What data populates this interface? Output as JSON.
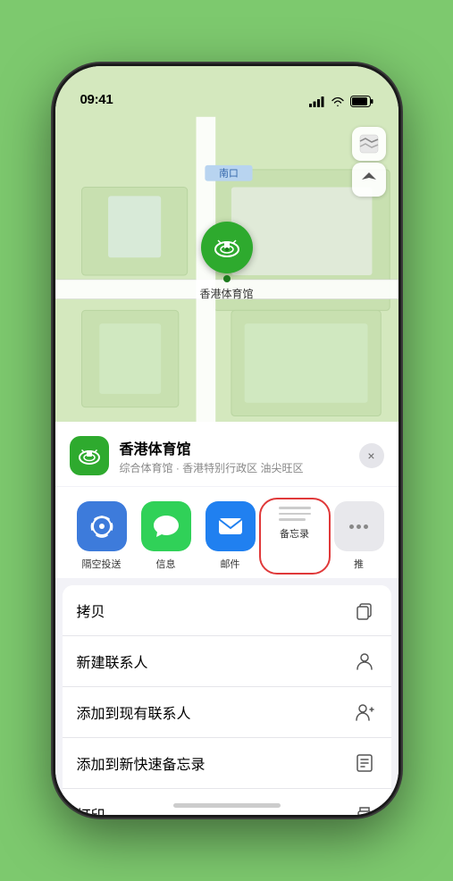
{
  "status": {
    "time": "09:41",
    "location_arrow": "▶"
  },
  "map": {
    "road_label": "南口",
    "controls": {
      "map_icon": "🗺",
      "location_icon": "➤"
    }
  },
  "venue": {
    "name": "香港体育馆",
    "subtitle": "综合体育馆 · 香港特别行政区 油尖旺区",
    "poi_label": "香港体育馆"
  },
  "share_items": [
    {
      "id": "airdrop",
      "label": "隔空投送",
      "type": "airdrop"
    },
    {
      "id": "messages",
      "label": "信息",
      "type": "messages"
    },
    {
      "id": "mail",
      "label": "邮件",
      "type": "mail"
    },
    {
      "id": "notes",
      "label": "备忘录",
      "type": "notes",
      "selected": true
    }
  ],
  "actions": [
    {
      "id": "copy",
      "label": "拷贝",
      "icon": "copy"
    },
    {
      "id": "new-contact",
      "label": "新建联系人",
      "icon": "person"
    },
    {
      "id": "add-existing",
      "label": "添加到现有联系人",
      "icon": "person-add"
    },
    {
      "id": "add-notes",
      "label": "添加到新快速备忘录",
      "icon": "notes-add"
    },
    {
      "id": "print",
      "label": "打印",
      "icon": "print"
    }
  ],
  "close_label": "×"
}
